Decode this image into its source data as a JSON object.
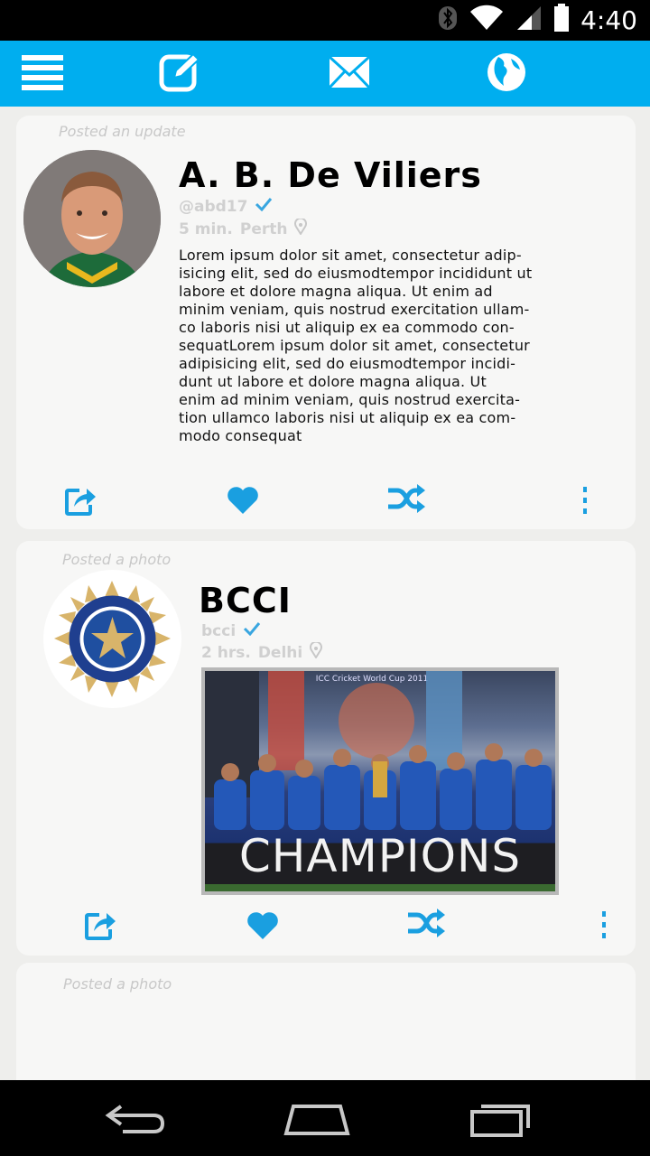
{
  "status": {
    "time": "4:40"
  },
  "toolbar": {
    "menu_icon": "menu-icon",
    "compose_icon": "compose-icon",
    "mail_icon": "mail-icon",
    "globe_icon": "globe-icon"
  },
  "colors": {
    "accent": "#00aeef",
    "card_bg": "#f7f7f6",
    "meta_gray": "#d0d0d0"
  },
  "posts": [
    {
      "posted_label": "Posted an update",
      "name": "A. B. De Viliers",
      "handle": "@abd17",
      "time": "5 min.",
      "location": "Perth",
      "text": "Lorem ipsum dolor sit amet, consectetur adip-\nisicing elit, sed do eiusmodtempor incididunt ut\nlabore et dolore magna aliqua. Ut enim ad\nminim veniam, quis nostrud exercitation ullam-\nco laboris nisi ut aliquip ex ea commodo con-\nsequatLorem ipsum dolor sit amet, consectetur\nadipisicing elit, sed do eiusmodtempor incidi-\ndunt ut labore et dolore magna aliqua. Ut\nenim ad minim veniam, quis nostrud exercita-\ntion ullamco laboris nisi ut aliquip ex ea com-\nmodo consequat"
    },
    {
      "posted_label": "Posted a photo",
      "name": "BCCI",
      "handle": "bcci",
      "time": "2 hrs.",
      "location": "Delhi",
      "photo_banner": "CHAMPIONS",
      "photo_caption": "ICC Cricket World Cup 2011"
    },
    {
      "posted_label": "Posted a photo"
    }
  ]
}
